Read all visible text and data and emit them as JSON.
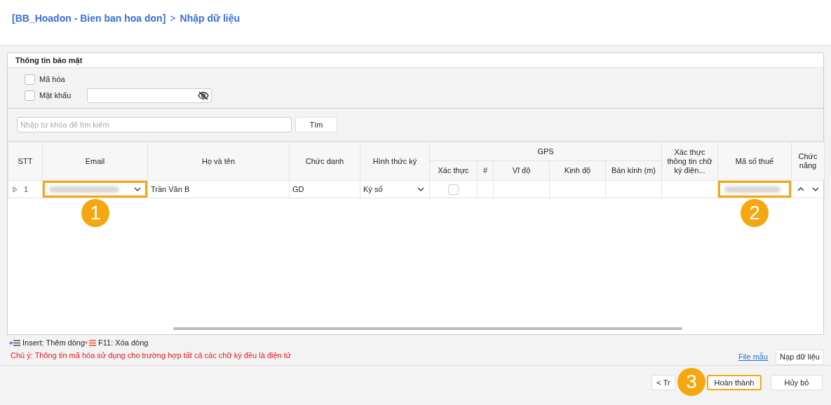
{
  "breadcrumb": {
    "parent": "[BB_Hoadon - Bien ban hoa don]",
    "separator": ">",
    "current": "Nhập dữ liệu"
  },
  "security": {
    "title": "Thông tin bảo mật",
    "options": [
      {
        "kind": "checkbox",
        "label": "Mã hóa",
        "checked": false
      },
      {
        "kind": "password",
        "label": "Mật khẩu",
        "checked": false
      }
    ]
  },
  "search": {
    "placeholder": "Nhập từ khóa để tìm kiếm",
    "button": "Tìm"
  },
  "table": {
    "columns": [
      {
        "label": "STT"
      },
      {
        "label": "Email"
      },
      {
        "label": "Họ và tên"
      },
      {
        "label": "Chức danh"
      },
      {
        "label": "Hình thức ký"
      },
      {
        "label": "GPS",
        "children": [
          {
            "label": "Xác thực"
          },
          {
            "label": "#"
          },
          {
            "label": "Vĩ độ"
          },
          {
            "label": "Kinh độ"
          },
          {
            "label": "Bán kính (m)"
          }
        ]
      },
      {
        "label": "Xác thực thông tin chữ ký điện..."
      },
      {
        "label": "Mã số thuế"
      },
      {
        "label": "Chức năng"
      }
    ],
    "rows": [
      {
        "stt": "1",
        "expanded": false,
        "email_callout": "1",
        "name": "Trần Văn B",
        "title": "GD",
        "sign_method": "Ký số",
        "gps_verified": false,
        "tax_callout": "2"
      }
    ]
  },
  "shortcuts": [
    {
      "kind": "insert",
      "text": "Insert: Thêm dòng"
    },
    {
      "kind": "delete",
      "text": "F11: Xóa dòng"
    }
  ],
  "note": "Chú ý: Thông tin mã hóa sử dụng cho trường hợp tất cả các chữ ký đều là điện tử",
  "template_link": "File mẫu",
  "load_button": "Nạp dữ liệu",
  "buttons": [
    {
      "label": "< Tr"
    },
    {
      "label": "Hoàn thành",
      "callout": "3"
    },
    {
      "label": "Hủy bỏ"
    }
  ]
}
